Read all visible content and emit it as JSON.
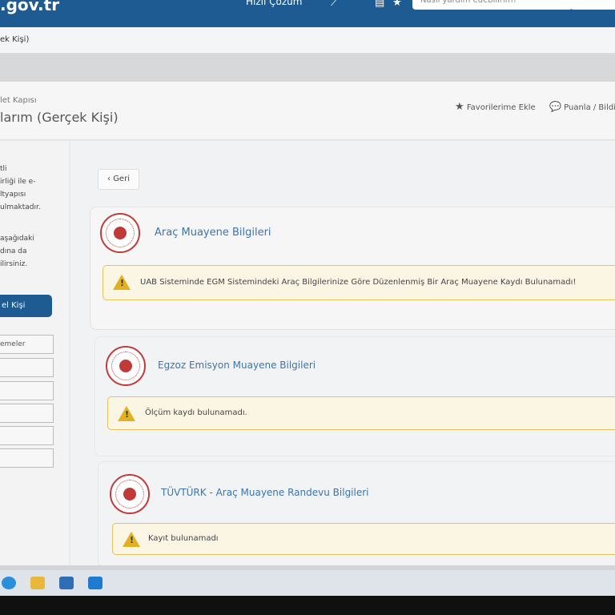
{
  "header": {
    "logo": ".gov.tr",
    "quick_solution": "Hızlı Çözüm",
    "search_placeholder": "Nasıl yardım edebilirim?"
  },
  "breadcrumb": {
    "text": "ek Kişi)"
  },
  "page": {
    "subtitle": "let Kapısı",
    "title": "larım (Gerçek Kişi)",
    "favorites": "Favorilerime Ekle",
    "rate": "Puanla / Bildir"
  },
  "sidebar": {
    "para1": [
      "tli",
      "irliği ile e-",
      "ltyapısı",
      "ulmaktadır."
    ],
    "para2": [
      "aşağıdaki",
      "dına da",
      "ilirsiniz."
    ],
    "button": "el Kişi",
    "field1": "emeler"
  },
  "back_button": "Geri",
  "sections": [
    {
      "title": "Araç Muayene Bilgileri",
      "message": "UAB Sisteminde EGM Sistemindeki Araç Bilgilerinize Göre Düzenlenmiş Bir Araç Muayene Kaydı Bulunamadı!"
    },
    {
      "title": "Egzoz Emisyon Muayene Bilgileri",
      "message": "Ölçüm kaydı bulunamadı."
    },
    {
      "title": "TÜVTÜRK - Araç Muayene Randevu Bilgileri",
      "message": "Kayıt bulunamadı"
    }
  ],
  "colors": {
    "brand": "#1f5b93",
    "link": "#3b74ad",
    "warning": "#e2b021",
    "seal": "#c13a3a"
  }
}
